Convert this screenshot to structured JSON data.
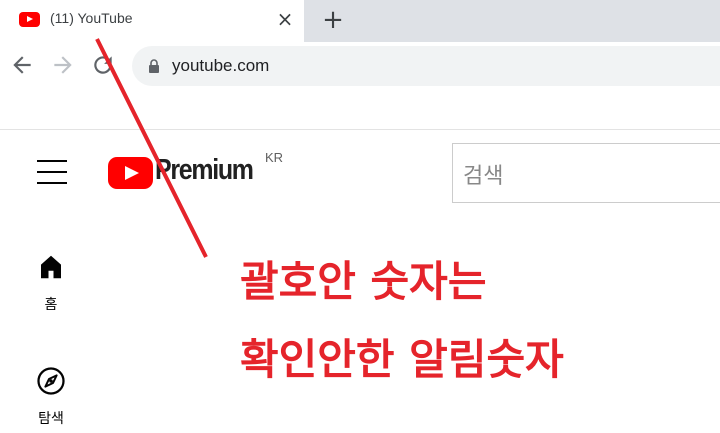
{
  "browser": {
    "tab": {
      "title": "(11) YouTube",
      "close_label": "×"
    },
    "newtab_label": "+",
    "url": "youtube.com"
  },
  "header": {
    "logo_text": "Premium",
    "region": "KR",
    "search_placeholder": "검색"
  },
  "sidebar": {
    "items": [
      {
        "label": "홈",
        "icon": "home-icon"
      },
      {
        "label": "탐색",
        "icon": "explore-icon"
      }
    ]
  },
  "annotation": {
    "line1": "괄호안 숫자는",
    "line2": "확인안한 알림숫자",
    "color": "#e5242b"
  }
}
